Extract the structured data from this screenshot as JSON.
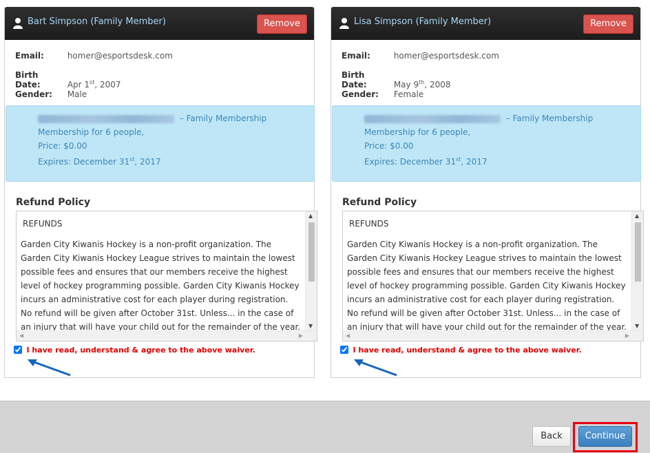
{
  "cards": [
    {
      "name": "Bart Simpson (Family Member)",
      "remove_label": "Remove",
      "email_label": "Email:",
      "email": "homer@esportsdesk.com",
      "birth_label": "Birth Date:",
      "birth_month_day": "Apr 1",
      "birth_suffix": "st",
      "birth_year": ", 2007",
      "gender_label": "Gender:",
      "gender": "Male",
      "membership": {
        "title_suffix": " – Family Membership",
        "people": "Membership for 6 people,",
        "price": "Price: $0.00",
        "expires_prefix": "Expires: December 31",
        "expires_suffix": "st",
        "expires_year": ", 2017"
      },
      "refund_title": "Refund Policy",
      "refund_heading": "REFUNDS",
      "refund_body": "Garden City Kiwanis Hockey is a non-profit organization. The Garden City Kiwanis Hockey League strives to maintain the lowest possible fees and ensures that our members receive the highest level of hockey programming possible. Garden City Kiwanis Hockey incurs an administrative cost for each player during registration. No refund will be given after October 31st. Unless... in the case of an injury that will have your child out for the remainder of the year.  At which time your",
      "agree_label": "I have read, understand & agree to the above waiver.",
      "agree_checked": true
    },
    {
      "name": "Lisa Simpson (Family Member)",
      "remove_label": "Remove",
      "email_label": "Email:",
      "email": "homer@esportsdesk.com",
      "birth_label": "Birth Date:",
      "birth_month_day": "May 9",
      "birth_suffix": "th",
      "birth_year": ", 2008",
      "gender_label": "Gender:",
      "gender": "Female",
      "membership": {
        "title_suffix": " – Family Membership",
        "people": "Membership for 6 people,",
        "price": "Price: $0.00",
        "expires_prefix": "Expires: December 31",
        "expires_suffix": "st",
        "expires_year": ", 2017"
      },
      "refund_title": "Refund Policy",
      "refund_heading": "REFUNDS",
      "refund_body": "Garden City Kiwanis Hockey is a non-profit organization. The Garden City Kiwanis Hockey League strives to maintain the lowest possible fees and ensures that our members receive the highest level of hockey programming possible. Garden City Kiwanis Hockey incurs an administrative cost for each player during registration. No refund will be given after October 31st. Unless... in the case of an injury that will have your child out for the remainder of the year.  At which time your",
      "agree_label": "I have read, understand & agree to the above waiver.",
      "agree_checked": true
    }
  ],
  "footer": {
    "back_label": "Back",
    "continue_label": "Continue"
  },
  "colors": {
    "header_bg": "#1c1c1c",
    "remove_bg": "#d9534f",
    "membership_bg": "#bfe6f7",
    "agree_text": "#e00000",
    "annotation_arrow": "#1565c0",
    "highlight_box": "#e8000f",
    "continue_bg": "#3a7fc0"
  },
  "icons": [
    "user-icon",
    "annotation-arrow",
    "scroll-up-arrow",
    "scroll-down-arrow",
    "scroll-left-arrow",
    "scroll-right-arrow"
  ]
}
